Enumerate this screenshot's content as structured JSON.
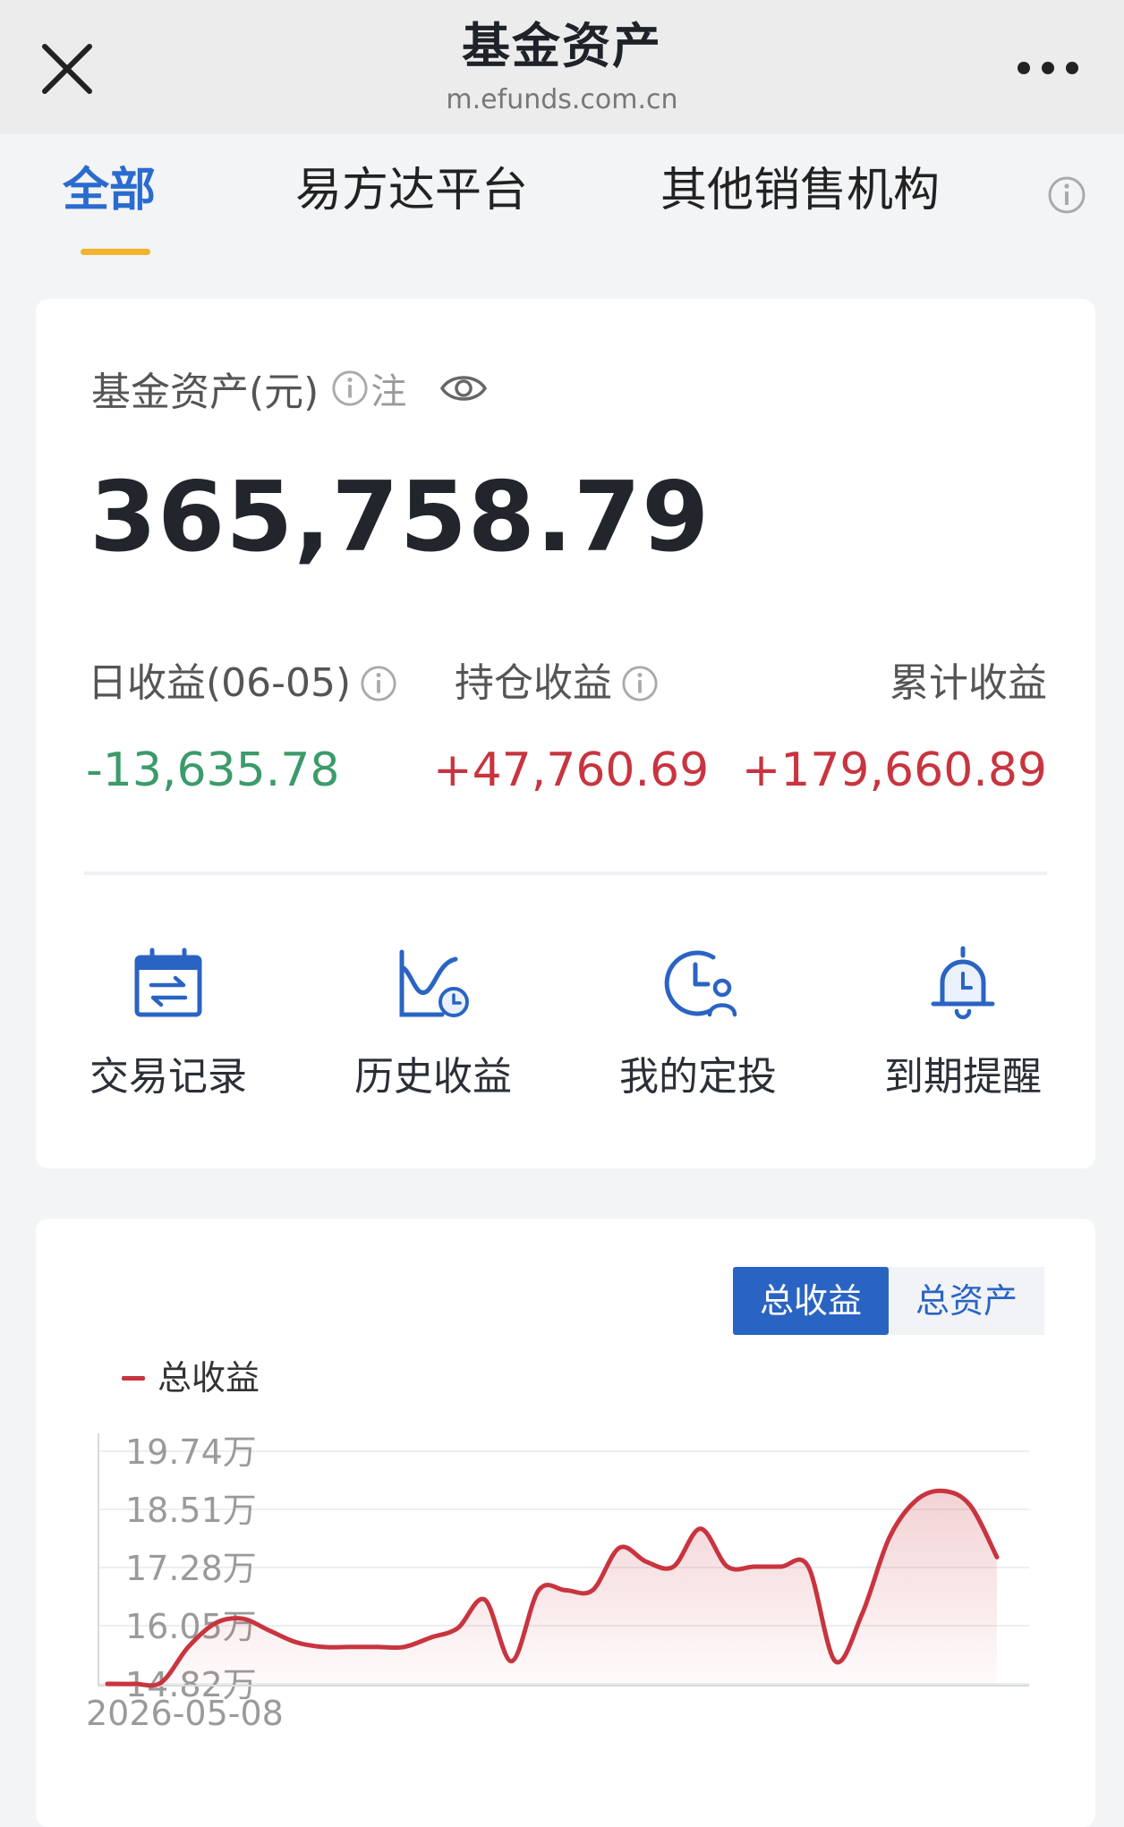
{
  "topbar": {
    "title": "基金资产",
    "url": "m.efunds.com.cn"
  },
  "tabs": [
    {
      "label": "全部"
    },
    {
      "label": "易方达平台"
    },
    {
      "label": "其他销售机构"
    }
  ],
  "summary": {
    "asset_label": "基金资产(元)",
    "note_label": "注",
    "asset_value": "365,758.79",
    "stats": [
      {
        "label": "日收益(06-05)",
        "value": "-13,635.78",
        "status": "negative"
      },
      {
        "label": "持仓收益",
        "value": "+47,760.69",
        "status": "positive"
      },
      {
        "label": "累计收益",
        "value": "+179,660.89",
        "status": "positive"
      }
    ],
    "colors": {
      "positive": "#c8343f",
      "negative": "#3c9a6b",
      "accent": "#2a6bcf"
    }
  },
  "shortcuts": [
    {
      "label": "交易记录",
      "icon": "calendar-exchange-icon"
    },
    {
      "label": "历史收益",
      "icon": "chart-clock-icon"
    },
    {
      "label": "我的定投",
      "icon": "clock-user-icon"
    },
    {
      "label": "到期提醒",
      "icon": "bell-icon"
    }
  ],
  "chart_toggle": {
    "active": "总收益",
    "inactive": "总资产"
  },
  "chart_data": {
    "type": "area",
    "legend": "总收益",
    "y_tick_labels": [
      "19.74万",
      "18.51万",
      "17.28万",
      "16.05万",
      "14.82万"
    ],
    "ylim": [
      14.82,
      19.74
    ],
    "y_unit": "万",
    "x_tick_labels": [
      "2026-05-08"
    ],
    "grid": true,
    "series": [
      {
        "name": "总收益",
        "color": "#c8343f",
        "values": [
          14.82,
          14.82,
          14.85,
          15.6,
          16.1,
          16.2,
          15.95,
          15.7,
          15.6,
          15.6,
          15.6,
          15.6,
          15.8,
          16.0,
          16.6,
          15.3,
          16.8,
          16.8,
          16.8,
          17.7,
          17.4,
          17.3,
          18.1,
          17.3,
          17.3,
          17.3,
          17.3,
          15.3,
          16.3,
          17.9,
          18.7,
          18.9,
          18.6,
          17.5
        ]
      }
    ]
  }
}
